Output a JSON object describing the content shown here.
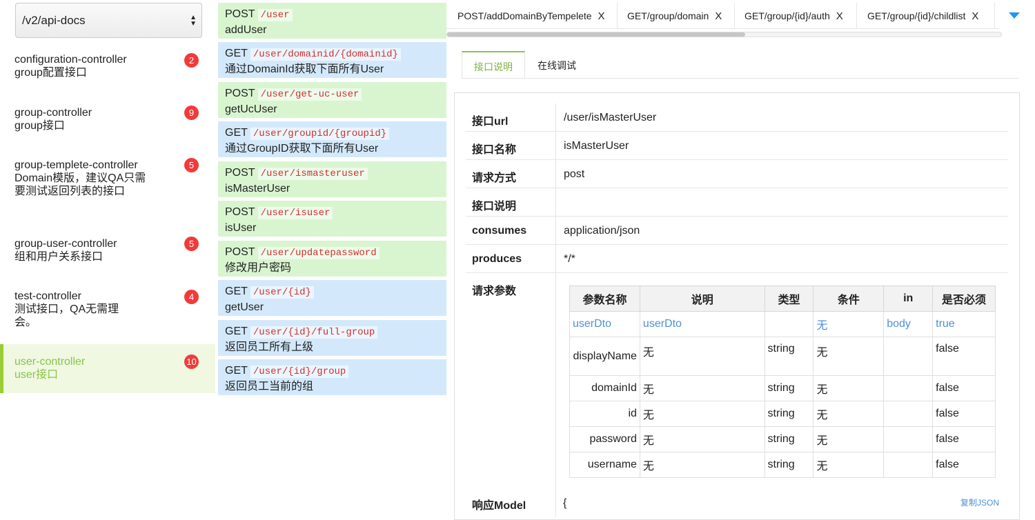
{
  "select": {
    "value": "/v2/api-docs"
  },
  "controllers": [
    {
      "name": "configuration-controller",
      "desc": "group配置接口",
      "count": "2"
    },
    {
      "name": "group-controller",
      "desc": "group接口",
      "count": "9"
    },
    {
      "name": "group-templete-controller",
      "desc": "Domain模版，建议QA只需要测试返回列表的接口",
      "count": "5"
    },
    {
      "name": "group-user-controller",
      "desc": "组和用户关系接口",
      "count": "5"
    },
    {
      "name": "test-controller",
      "desc": "测试接口，QA无需理会。",
      "count": "4"
    },
    {
      "name": "user-controller",
      "desc": "user接口",
      "count": "10"
    }
  ],
  "apis": [
    {
      "method": "POST",
      "path": "/user",
      "desc": "addUser"
    },
    {
      "method": "GET",
      "path": "/user/domainid/{domainid}",
      "desc": "通过DomainId获取下面所有User"
    },
    {
      "method": "POST",
      "path": "/user/get-uc-user",
      "desc": "getUcUser"
    },
    {
      "method": "GET",
      "path": "/user/groupid/{groupid}",
      "desc": "通过GroupID获取下面所有User"
    },
    {
      "method": "POST",
      "path": "/user/ismasteruser",
      "desc": "isMasterUser"
    },
    {
      "method": "POST",
      "path": "/user/isuser",
      "desc": "isUser"
    },
    {
      "method": "POST",
      "path": "/user/updatepassword",
      "desc": "修改用户密码"
    },
    {
      "method": "GET",
      "path": "/user/{id}",
      "desc": "getUser"
    },
    {
      "method": "GET",
      "path": "/user/{id}/full-group",
      "desc": "返回员工所有上级"
    },
    {
      "method": "GET",
      "path": "/user/{id}/group",
      "desc": "返回员工当前的组"
    }
  ],
  "tabs": [
    {
      "label": "POST/addDomainByTempelete",
      "close": "X"
    },
    {
      "label": "GET/group/domain",
      "close": "X"
    },
    {
      "label": "GET/group/{id}/auth",
      "close": "X"
    },
    {
      "label": "GET/group/{id}/childlist",
      "close": "X"
    }
  ],
  "subtabs": {
    "doc": "接口说明",
    "debug": "在线调试"
  },
  "info": {
    "url_label": "接口url",
    "url": "/user/isMasterUser",
    "name_label": "接口名称",
    "name": "isMasterUser",
    "method_label": "请求方式",
    "method": "post",
    "desc_label": "接口说明",
    "desc": "",
    "consumes_label": "consumes",
    "consumes": "application/json",
    "produces_label": "produces",
    "produces": "*/*",
    "params_label": "请求参数"
  },
  "param_headers": [
    "参数名称",
    "说明",
    "类型",
    "条件",
    "in",
    "是否必须"
  ],
  "params": [
    [
      "userDto",
      "userDto",
      "",
      "无",
      "body",
      "true"
    ],
    [
      "displayName",
      "无",
      "string",
      "无",
      "",
      "false"
    ],
    [
      "domainId",
      "无",
      "string",
      "无",
      "",
      "false"
    ],
    [
      "id",
      "无",
      "string",
      "无",
      "",
      "false"
    ],
    [
      "password",
      "无",
      "string",
      "无",
      "",
      "false"
    ],
    [
      "username",
      "无",
      "string",
      "无",
      "",
      "false"
    ]
  ],
  "response": {
    "label": "响应Model",
    "brace": "{",
    "copy": "复制JSON"
  },
  "colors": {
    "accent": "#8bc34a",
    "post_bg": "#d8f5d0",
    "get_bg": "#d3e9fb",
    "badge": "#f23a3a",
    "path": "#d03030",
    "link": "#4a90d9"
  }
}
